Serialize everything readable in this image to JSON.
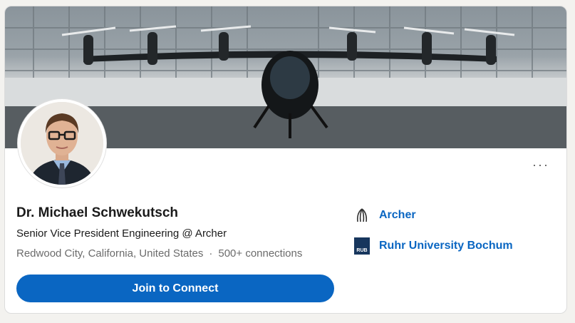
{
  "profile": {
    "name": "Dr. Michael Schwekutsch",
    "headline": "Senior Vice President Engineering @ Archer",
    "location": "Redwood City, California, United States",
    "separator": "·",
    "connections": "500+ connections"
  },
  "actions": {
    "join_label": "Join to Connect",
    "more_label": "···"
  },
  "side": {
    "company": {
      "label": "Archer",
      "icon": "archer-logo-icon"
    },
    "education": {
      "label": "Ruhr University Bochum",
      "icon": "rub-logo-icon",
      "logo_text": "RUB"
    }
  },
  "colors": {
    "accent": "#0a66c2",
    "rub_blue": "#17365d"
  }
}
